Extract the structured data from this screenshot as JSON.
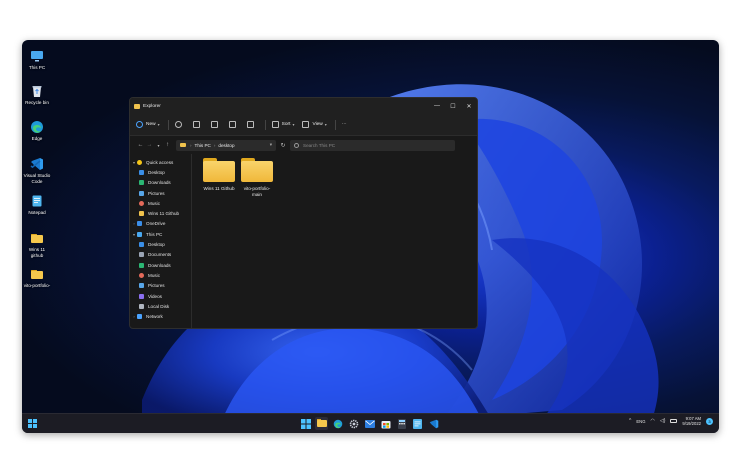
{
  "desktop": {
    "icons": [
      {
        "label": "This PC",
        "icon": "this-pc-icon"
      },
      {
        "label": "Recycle bin",
        "icon": "recycle-bin-icon"
      },
      {
        "label": "Edge",
        "icon": "edge-icon"
      },
      {
        "label": "Visual Studio Code",
        "icon": "vscode-icon"
      },
      {
        "label": "Notepad",
        "icon": "notepad-icon"
      },
      {
        "label": "Wins 11 github",
        "icon": "folder-icon"
      },
      {
        "label": "vito-portfolio-",
        "icon": "folder-icon"
      }
    ]
  },
  "explorer": {
    "title": "Explorer",
    "window_controls": [
      "—",
      "☐",
      "✕"
    ],
    "toolbar": {
      "new_label": "New",
      "sort_label": "Sort",
      "view_label": "View",
      "more_label": "···"
    },
    "address": {
      "path": [
        "This PC",
        "desktop"
      ],
      "separator": "›",
      "search_placeholder": "Search This PC"
    },
    "nav": [
      {
        "label": "Quick access",
        "icon": "star-icon",
        "color": "#f5c518",
        "level": 0,
        "arrow": "▾"
      },
      {
        "label": "Desktop",
        "icon": "desktop-icon",
        "color": "#3a8ee6",
        "level": 1
      },
      {
        "label": "Downloads",
        "icon": "download-icon",
        "color": "#2bb673",
        "level": 1
      },
      {
        "label": "Pictures",
        "icon": "pictures-icon",
        "color": "#58a6e8",
        "level": 1
      },
      {
        "label": "Music",
        "icon": "music-icon",
        "color": "#e46a5a",
        "level": 1
      },
      {
        "label": "Wins 11 Github",
        "icon": "folder-icon",
        "color": "#f1c34d",
        "level": 1
      },
      {
        "label": "OneDrive",
        "icon": "onedrive-icon",
        "color": "#3b8ee8",
        "level": 0,
        "arrow": "›"
      },
      {
        "label": "This PC",
        "icon": "this-pc-icon",
        "color": "#49a8f0",
        "level": 0,
        "arrow": "▾"
      },
      {
        "label": "Desktop",
        "icon": "desktop-icon",
        "color": "#3a8ee6",
        "level": 1
      },
      {
        "label": "Documents",
        "icon": "documents-icon",
        "color": "#9aa4b4",
        "level": 1
      },
      {
        "label": "Downloads",
        "icon": "download-icon",
        "color": "#2bb673",
        "level": 1
      },
      {
        "label": "Music",
        "icon": "music-icon",
        "color": "#e46a5a",
        "level": 1
      },
      {
        "label": "Pictures",
        "icon": "pictures-icon",
        "color": "#58a6e8",
        "level": 1
      },
      {
        "label": "Videos",
        "icon": "videos-icon",
        "color": "#8b6ff0",
        "level": 1
      },
      {
        "label": "Local Disk",
        "icon": "disk-icon",
        "color": "#b0b6c0",
        "level": 1
      },
      {
        "label": "Network",
        "icon": "network-icon",
        "color": "#4aa3ff",
        "level": 0,
        "arrow": "›"
      }
    ],
    "folders": [
      {
        "label": "Wins 11 Github"
      },
      {
        "label": "vito-portfolio-main"
      }
    ]
  },
  "taskbar": {
    "apps": [
      "start-icon",
      "file-explorer-icon",
      "edge-icon",
      "settings-icon",
      "mail-icon",
      "store-icon",
      "calculator-icon",
      "notepad-icon",
      "vscode-icon"
    ],
    "tray": {
      "lang": "ENG",
      "time": "9:07 AM",
      "date": "9/19/2022",
      "notif_count": "3"
    },
    "accent": "#4cc2ff"
  }
}
